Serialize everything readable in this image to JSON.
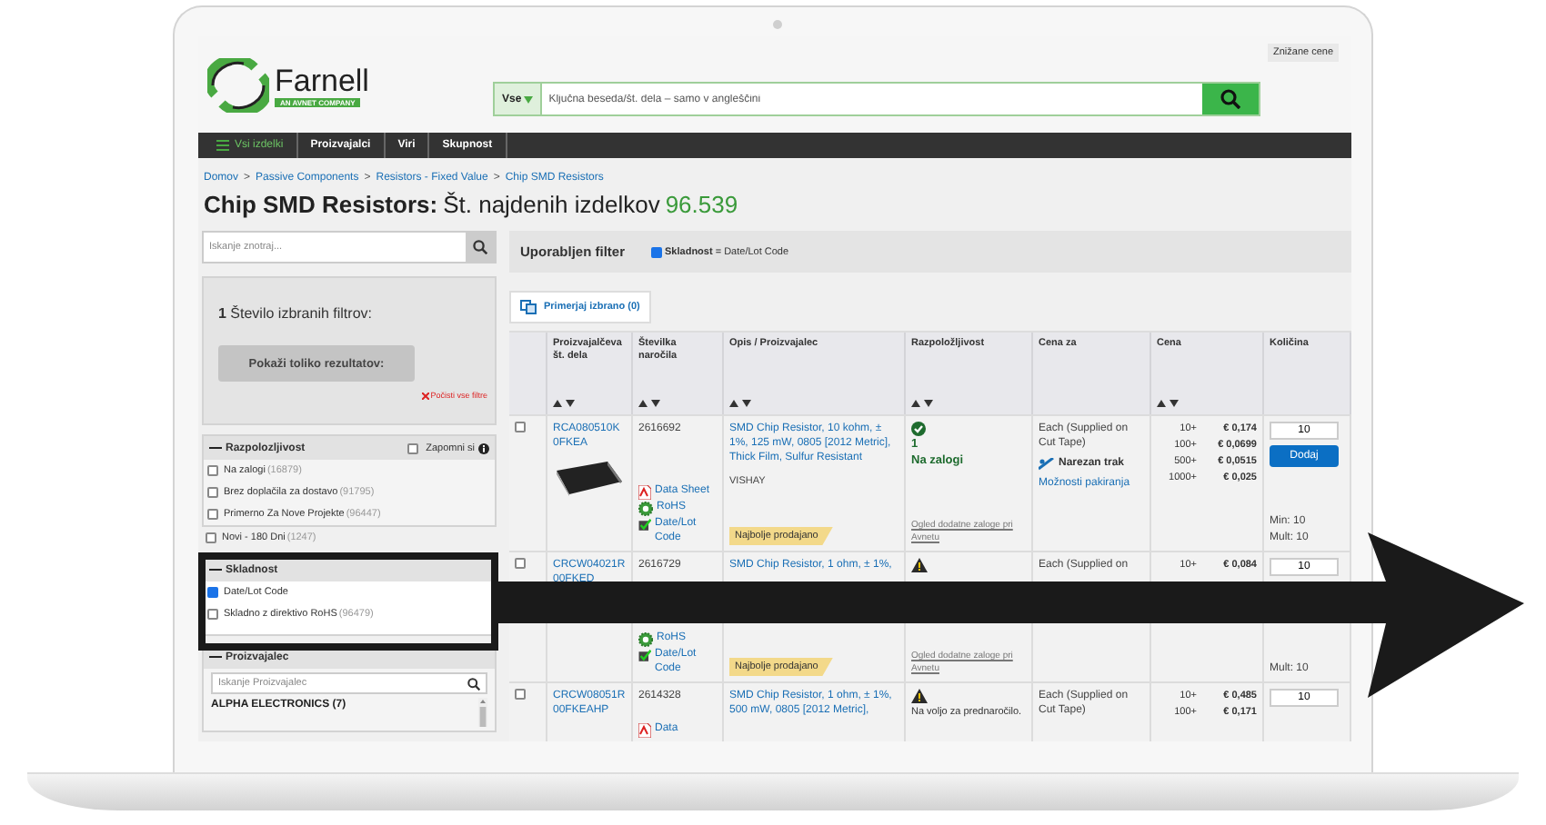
{
  "header": {
    "deal_link": "Znižane cene",
    "logo": {
      "name": "Farnell",
      "tagline": "AN AVNET COMPANY"
    },
    "search": {
      "scope": "Vse",
      "placeholder": "Ključna beseda/št. dela – samo v angleščini"
    }
  },
  "nav": [
    {
      "label": "Vsi izdelki",
      "kind": "menu"
    },
    {
      "label": "Proizvajalci",
      "kind": "link"
    },
    {
      "label": "Viri",
      "kind": "link"
    },
    {
      "label": "Skupnost",
      "kind": "link"
    }
  ],
  "breadcrumb": {
    "separator": ">",
    "items": [
      "Domov",
      "Passive Components",
      "Resistors - Fixed Value",
      "Chip SMD Resistors"
    ]
  },
  "title": {
    "text": "Chip SMD Resistors:",
    "label": "Št. najdenih izdelkov",
    "count": "96.539"
  },
  "sidebar": {
    "search_placeholder": "Iskanje znotraj...",
    "filter_count": "1",
    "filter_label": "Število izbranih filtrov:",
    "show_button": "Pokaži toliko rezultatov:",
    "clear_link": "Počisti vse filtre",
    "availability": {
      "title": "Razpolozljivost",
      "remember": {
        "label": "Zapomni si",
        "checked": false
      },
      "options": [
        {
          "label": "Na zalogi",
          "count": "(16879)",
          "checked": false
        },
        {
          "label": "Brez doplačila za dostavo",
          "count": "(91795)",
          "checked": false
        },
        {
          "label": "Primerno Za Nove Projekte",
          "count": "(96447)",
          "checked": false
        }
      ],
      "extra": {
        "label": "Novi - 180 Dni",
        "count": "(1247)",
        "checked": false
      }
    },
    "compliance": {
      "title": "Skladnost",
      "options": [
        {
          "label": "Date/Lot Code",
          "checked": true
        },
        {
          "label": "Skladno z direktivo RoHS",
          "count": "(96479)",
          "checked": false
        }
      ]
    },
    "manufacturer": {
      "title": "Proizvajalec",
      "search_placeholder": "Iskanje Proizvajalec",
      "options": [
        "ALPHA ELECTRONICS (7)"
      ]
    }
  },
  "applied_filter": {
    "title": "Uporabljen filter",
    "chips": [
      {
        "label": "**Skladnost** = Date/Lot Code",
        "checked": true
      }
    ]
  },
  "compare_button": "Primerjaj izbrano (0)",
  "table": {
    "columns": [
      {
        "label": "Proizvajalčeva št. dela",
        "sortable": true
      },
      {
        "label": "Številka naročila",
        "sortable": true
      },
      {
        "label": "Opis / Proizvajalec",
        "sortable": true
      },
      {
        "label": "Razpoložljivost",
        "sortable": true
      },
      {
        "label": "Cena za",
        "sortable": false
      },
      {
        "label": "Cena",
        "sortable": true
      },
      {
        "label": "Količina",
        "sortable": false
      }
    ],
    "rows": [
      {
        "checked": false,
        "part": "RCA080510K0FKEA",
        "image": true,
        "order": "2616692",
        "docs": [
          {
            "kind": "datasheet",
            "label": "Data Sheet"
          },
          {
            "kind": "rohs",
            "label": "RoHS"
          },
          {
            "kind": "datelot",
            "label": "Date/Lot Code"
          }
        ],
        "description": "SMD Chip Resistor, 10 kohm, ± 1%, 125 mW, 0805 [2012 Metric], Thick Film, Sulfur Resistant",
        "maker": "VISHAY",
        "badge": "Najbolje prodajano",
        "availability": {
          "kind": "in_stock",
          "count": "1",
          "text": "Na zalogi",
          "link": "Ogled dodatne zaloge pri Avnetu"
        },
        "price_for": "Each (Supplied on Cut Tape)",
        "packaging": "Narezan trak",
        "options_link": "Možnosti pakiranja",
        "prices": [
          {
            "qty": "10+",
            "price": "€ 0,174"
          },
          {
            "qty": "100+",
            "price": "€ 0,0699"
          },
          {
            "qty": "500+",
            "price": "€ 0,0515"
          },
          {
            "qty": "1000+",
            "price": "€ 0,025"
          }
        ],
        "quantity": "10",
        "add_button": "Dodaj",
        "min": "Min: 10",
        "mult": "Mult: 10"
      },
      {
        "checked": false,
        "part": "CRCW04021R00FKED",
        "image": false,
        "order": "2616729",
        "docs": [
          {
            "kind": "rohs",
            "label": "RoHS"
          },
          {
            "kind": "datelot",
            "label": "Date/Lot Code"
          }
        ],
        "description": "SMD Chip Resistor, 1 ohm, ± 1%,",
        "badge": "Najbolje prodajano",
        "availability": {
          "kind": "preorder",
          "link": "Ogled dodatne zaloge pri Avnetu"
        },
        "price_for": "Each (Supplied on",
        "prices": [
          {
            "qty": "10+",
            "price": "€ 0,084"
          }
        ],
        "quantity": "10",
        "mult": "Mult: 10"
      },
      {
        "checked": false,
        "part": "CRCW08051R00FKEAHP",
        "image": false,
        "order": "2614328",
        "docs": [
          {
            "kind": "datasheet",
            "label": "Data"
          }
        ],
        "description": "SMD Chip Resistor, 1 ohm, ± 1%, 500 mW, 0805 [2012 Metric],",
        "availability": {
          "kind": "preorder",
          "text": "Na voljo za prednaročilo."
        },
        "price_for": "Each (Supplied on Cut Tape)",
        "prices": [
          {
            "qty": "10+",
            "price": "€ 0,485"
          },
          {
            "qty": "100+",
            "price": "€ 0,171"
          }
        ],
        "quantity": "10"
      }
    ]
  }
}
